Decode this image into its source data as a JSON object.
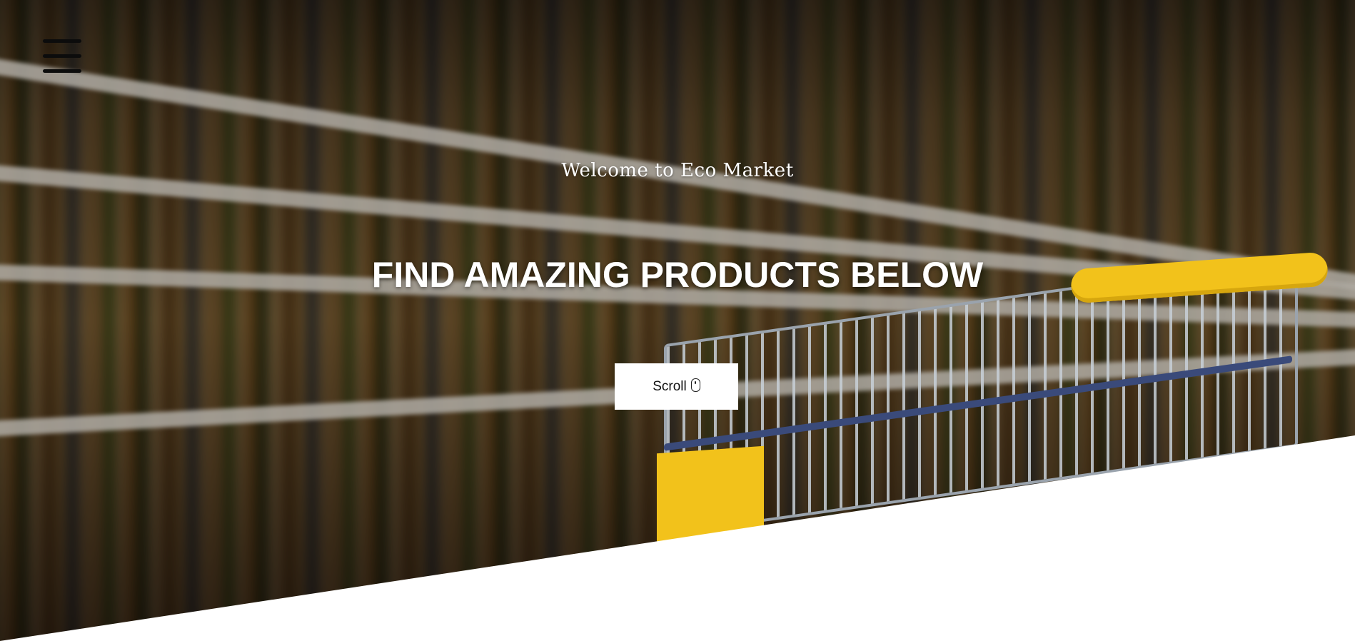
{
  "hero": {
    "welcome_text": "Welcome to Eco Market",
    "headline": "FIND AMAZING PRODUCTS BELOW",
    "scroll_button_label": "Scroll",
    "scroll_button_icon": "mouse-icon"
  },
  "nav": {
    "menu_icon": "hamburger-menu-icon"
  },
  "colors": {
    "headline_text": "#ffffff",
    "menu_icon": "#0c0c0c",
    "button_background": "#ffffff",
    "cart_yellow": "#f2c21b"
  }
}
